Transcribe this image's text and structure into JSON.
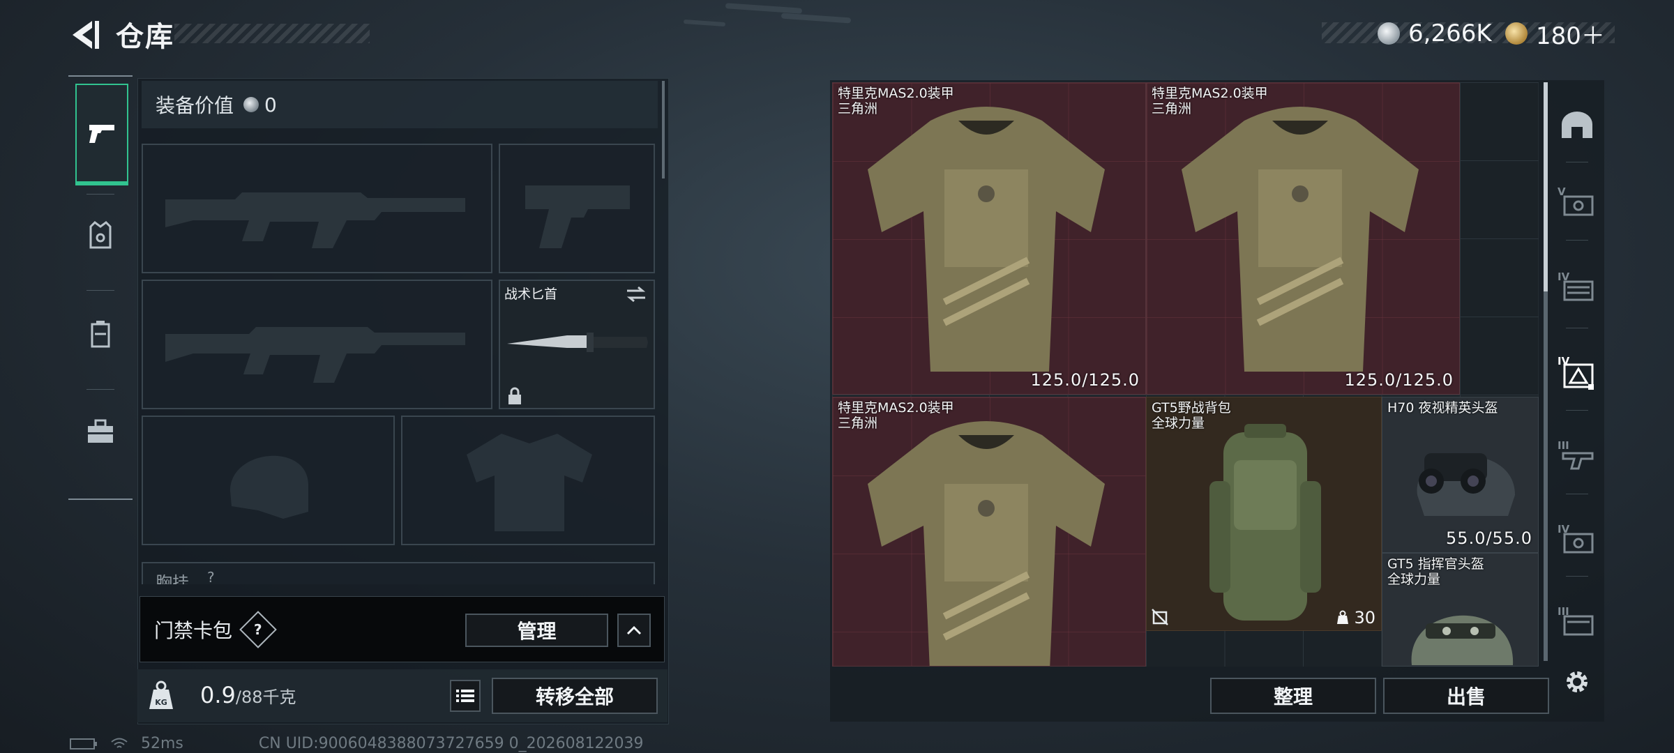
{
  "header": {
    "title": "仓库",
    "currency_main": "6,266K",
    "currency_premium": "180＋"
  },
  "loadout": {
    "value_label": "装备价值",
    "value_amount": "0",
    "melee_name": "战术匕首",
    "chest_rig_label": "胸挂",
    "chest_rig_help": "?",
    "keycard_label": "门禁卡包",
    "keycard_help": "?",
    "manage_button": "管理",
    "weight_value": "0.9",
    "weight_max": "/88千克",
    "weight_icon_text": "KG",
    "transfer_all_button": "转移全部"
  },
  "stash": {
    "items": [
      {
        "name_line1": "特里克MAS2.0装甲",
        "name_line2": "三角洲",
        "durability": "125.0/125.0"
      },
      {
        "name_line1": "特里克MAS2.0装甲",
        "name_line2": "三角洲",
        "durability": "125.0/125.0"
      },
      {
        "name_line1": "特里克MAS2.0装甲",
        "name_line2": "三角洲",
        "durability": ""
      },
      {
        "name_line1": "GT5野战背包",
        "name_line2": "全球力量",
        "capacity": "30"
      },
      {
        "name_line1": "H70 夜视精英头盔",
        "name_line2": "",
        "durability": "55.0/55.0"
      },
      {
        "name_line1": "GT5 指挥官头盔",
        "name_line2": "全球力量",
        "durability": ""
      }
    ],
    "sort_button": "整理",
    "sell_button": "出售",
    "side_tabs": [
      "V",
      "IV",
      "IV",
      "III",
      "IV",
      "III"
    ]
  },
  "status": {
    "ping": "52ms",
    "uid": "CN UID:9006048388073727659 0_202608122039"
  },
  "colors": {
    "accent_green": "#31c38f",
    "armor_bg": "#40222a",
    "backpack_bg": "#33291f"
  }
}
